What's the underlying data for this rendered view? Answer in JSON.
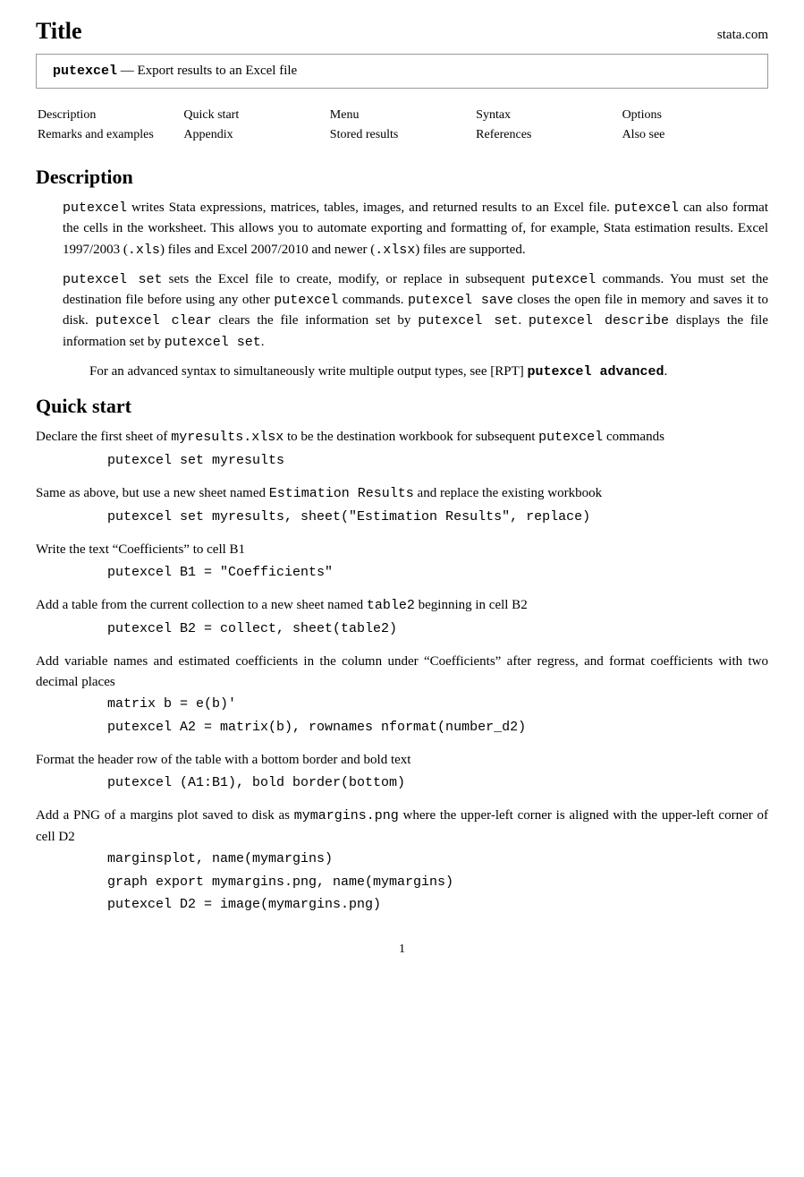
{
  "header": {
    "title": "Title",
    "brand": "stata.com"
  },
  "title_box": {
    "cmd": "putexcel",
    "rest": " — Export results to an Excel file"
  },
  "nav": {
    "rows": [
      [
        "Description",
        "Quick start",
        "Menu",
        "Syntax",
        "Options"
      ],
      [
        "Remarks and examples",
        "Appendix",
        "Stored results",
        "References",
        "Also see"
      ]
    ]
  },
  "description_section": {
    "heading": "Description",
    "paragraphs": [
      "putexcel writes Stata expressions, matrices, tables, images, and returned results to an Excel file. putexcel can also format the cells in the worksheet. This allows you to automate exporting and formatting of, for example, Stata estimation results. Excel 1997/2003 (.xls) files and Excel 2007/2010 and newer (.xlsx) files are supported.",
      "putexcel set sets the Excel file to create, modify, or replace in subsequent putexcel commands. You must set the destination file before using any other putexcel commands. putexcel save closes the open file in memory and saves it to disk. putexcel clear clears the file information set by putexcel set. putexcel describe displays the file information set by putexcel set.",
      "For an advanced syntax to simultaneously write multiple output types, see [RPT] putexcel advanced."
    ]
  },
  "quick_start_section": {
    "heading": "Quick start",
    "items": [
      {
        "text": "Declare the first sheet of myresults.xlsx to be the destination workbook for subsequent putexcel commands",
        "code_lines": [
          "putexcel set myresults"
        ]
      },
      {
        "text": "Same as above, but use a new sheet named Estimation Results and replace the existing workbook",
        "code_lines": [
          "putexcel set myresults, sheet(\"Estimation Results\", replace)"
        ]
      },
      {
        "text": "Write the text “Coefficients” to cell B1",
        "code_lines": [
          "putexcel B1 = \"Coefficients\""
        ]
      },
      {
        "text": "Add a table from the current collection to a new sheet named table2 beginning in cell B2",
        "code_lines": [
          "putexcel B2 = collect, sheet(table2)"
        ]
      },
      {
        "text": "Add variable names and estimated coefficients in the column under “Coefficients” after regress, and format coefficients with two decimal places",
        "code_lines": [
          "matrix b = e(b)'",
          "putexcel A2 = matrix(b), rownames nformat(number_d2)"
        ]
      },
      {
        "text": "Format the header row of the table with a bottom border and bold text",
        "code_lines": [
          "putexcel (A1:B1), bold border(bottom)"
        ]
      },
      {
        "text": "Add a PNG of a margins plot saved to disk as mymargins.png where the upper-left corner is aligned with the upper-left corner of cell D2",
        "code_lines": [
          "marginsplot, name(mymargins)",
          "graph export mymargins.png, name(mymargins)",
          "putexcel D2 = image(mymargins.png)"
        ]
      }
    ]
  },
  "footer": {
    "page_number": "1"
  }
}
